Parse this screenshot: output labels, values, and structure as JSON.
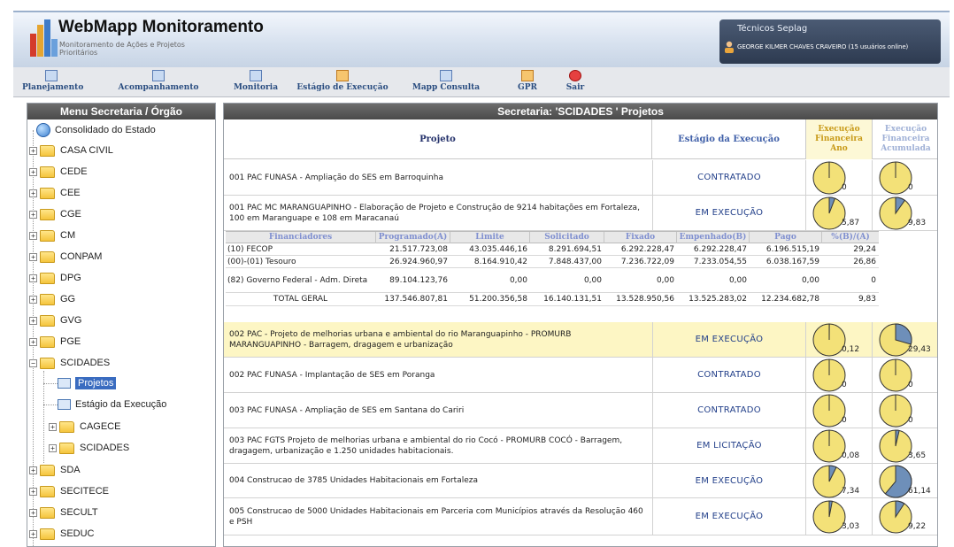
{
  "header": {
    "title": "WebMapp Monitoramento",
    "subtitle": "Monitoramento de Ações e Projetos Prioritários",
    "user_group": "Técnicos Seplag",
    "user_name": "GEORGE KILMER CHAVES CRAVEIRO (15 usuários online)"
  },
  "toolbar": {
    "items": [
      {
        "label": "Planejamento",
        "icon": "calendar-icon"
      },
      {
        "label": "Acompanhamento",
        "icon": "calendar-check-icon"
      },
      {
        "label": "Monitoria",
        "icon": "document-icon"
      },
      {
        "label": "Estágio de Execução",
        "icon": "chart-icon"
      },
      {
        "label": "Mapp Consulta",
        "icon": "search-window-icon"
      },
      {
        "label": "GPR",
        "icon": "grid-icon"
      },
      {
        "label": "Sair",
        "icon": "power-icon"
      }
    ]
  },
  "sidebar": {
    "title": "Menu Secretaria / Órgão",
    "root": "Consolidado do Estado",
    "items": [
      "CASA CIVIL",
      "CEDE",
      "CEE",
      "CGE",
      "CM",
      "CONPAM",
      "DPG",
      "GG",
      "GVG",
      "PGE",
      "SCIDADES"
    ],
    "scidades_children": [
      "Projetos",
      "Estágio da Execução",
      "CAGECE",
      "SCIDADES"
    ],
    "items_after": [
      "SDA",
      "SECITECE",
      "SECULT",
      "SEDUC"
    ]
  },
  "main": {
    "title": "Secretaria: 'SCIDADES ' Projetos",
    "columns": {
      "projeto": "Projeto",
      "estagio": "Estágio da Execução",
      "exec_ano": "Execução Financeira Ano",
      "exec_acum": "Execução Financeira Acumulada"
    },
    "projects": [
      {
        "name": "001 PAC FUNASA - Ampliação do SES em Barroquinha",
        "stage": "CONTRATADO",
        "ano": "0",
        "acum": "0",
        "ano_pct": 0,
        "acum_pct": 0
      },
      {
        "name": "001 PAC MC MARANGUAPINHO - Elaboração de Projeto e Construção de 9214 habitações em Fortaleza, 100 em Maranguape e 108 em Maracanaú",
        "stage": "EM EXECUÇÃO",
        "ano": "5,87",
        "acum": "9,83",
        "ano_pct": 5.87,
        "acum_pct": 9.83
      },
      {
        "name": "002 PAC - Projeto de melhorias urbana e ambiental do rio Maranguapinho - PROMURB MARANGUAPINHO - Barragem, dragagem e urbanização",
        "stage": "EM EXECUÇÃO",
        "ano": "0,12",
        "acum": "29,43",
        "ano_pct": 0.12,
        "acum_pct": 29.43
      },
      {
        "name": "002 PAC FUNASA - Implantação de SES em Poranga",
        "stage": "CONTRATADO",
        "ano": "0",
        "acum": "0",
        "ano_pct": 0,
        "acum_pct": 0
      },
      {
        "name": "003 PAC FUNASA - Ampliação de SES em Santana do Cariri",
        "stage": "CONTRATADO",
        "ano": "0",
        "acum": "0",
        "ano_pct": 0,
        "acum_pct": 0
      },
      {
        "name": "003 PAC FGTS Projeto de melhorias urbana e ambiental do rio Cocó - PROMURB COCÓ - Barragem, dragagem, urbanização e 1.250 unidades habitacionais.",
        "stage": "EM LICITAÇÃO",
        "ano": "0,08",
        "acum": "3,65",
        "ano_pct": 0.08,
        "acum_pct": 3.65
      },
      {
        "name": "004 Construcao de 3785 Unidades Habitacionais em Fortaleza",
        "stage": "EM EXECUÇÃO",
        "ano": "7,34",
        "acum": "61,14",
        "ano_pct": 7.34,
        "acum_pct": 61.14
      },
      {
        "name": "005 Construcao de 5000 Unidades Habitacionais em Parceria com Municípios através da Resolução 460 e PSH",
        "stage": "EM EXECUÇÃO",
        "ano": "3,03",
        "acum": "9,22",
        "ano_pct": 3.03,
        "acum_pct": 9.22
      }
    ],
    "financiadores": {
      "headers": [
        "Financiadores",
        "Programado(A)",
        "Limite",
        "Solicitado",
        "Fixado",
        "Empenhado(B)",
        "Pago",
        "%(B)/(A)"
      ],
      "rows": [
        [
          "(10) FECOP",
          "21.517.723,08",
          "43.035.446,16",
          "8.291.694,51",
          "6.292.228,47",
          "6.292.228,47",
          "6.196.515,19",
          "29,24"
        ],
        [
          "(00)-(01) Tesouro",
          "26.924.960,97",
          "8.164.910,42",
          "7.848.437,00",
          "7.236.722,09",
          "7.233.054,55",
          "6.038.167,59",
          "26,86"
        ],
        [
          "(82) Governo Federal - Adm. Direta",
          "89.104.123,76",
          "0,00",
          "0,00",
          "0,00",
          "0,00",
          "0,00",
          "0"
        ],
        [
          "TOTAL GERAL",
          "137.546.807,81",
          "51.200.356,58",
          "16.140.131,51",
          "13.528.950,56",
          "13.525.283,02",
          "12.234.682,78",
          "9,83"
        ]
      ]
    }
  },
  "colors": {
    "pie_fill": "#f3e178",
    "pie_acum_fill": "#f5e07a",
    "pie_slice": "#6e8fb9",
    "accent": "#23408a"
  }
}
